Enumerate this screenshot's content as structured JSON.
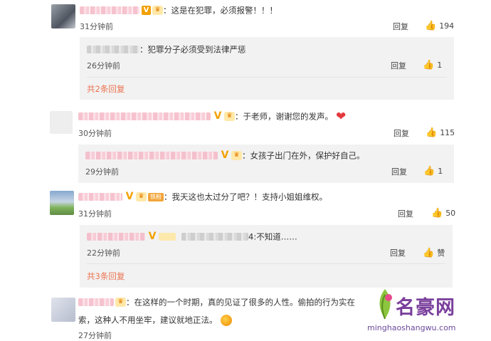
{
  "comments": [
    {
      "text": "：这是在犯罪，必须报警！！！",
      "time": "31分钟前",
      "reply_label": "回复",
      "likes": "194",
      "sub": [
        {
          "text": "：犯罪分子必须受到法律严惩",
          "time": "26分钟前",
          "reply_label": "回复",
          "likes": "1"
        }
      ],
      "more": "共2条回复"
    },
    {
      "text": "：于老师，谢谢您的发声。",
      "time": "30分钟前",
      "reply_label": "回复",
      "likes": "115",
      "sub": [
        {
          "text": "：女孩子出门在外，保护好自己。",
          "time": "29分钟前",
          "reply_label": "回复",
          "likes": "1"
        }
      ]
    },
    {
      "text": "：我天这也太过分了吧？！支持小姐姐维权。",
      "time": "31分钟前",
      "reply_label": "回复",
      "likes": "50",
      "badge": "铁粉",
      "sub": [
        {
          "text": "4:不知道……",
          "time": "22分钟前",
          "reply_label": "回复",
          "likes": "赞"
        }
      ],
      "more": "共3条回复"
    },
    {
      "text": "：在这样的一个时期，真的见证了很多的人性。偷拍的行为实在",
      "text2": "索，这种人不用坐牢，建议就地正法。",
      "time": "27分钟前"
    }
  ],
  "watermark": {
    "title": "名豪网",
    "url": "minghaoshangwu.com"
  },
  "colors": {
    "link": "#eb7350",
    "badge_gold": "#f2a100",
    "heart": "#e4393c",
    "watermark": "#7a3f9c"
  },
  "icons": [
    "thumb-up-icon",
    "vip-badge-icon",
    "crown-badge-icon",
    "heart-emoji-icon"
  ]
}
